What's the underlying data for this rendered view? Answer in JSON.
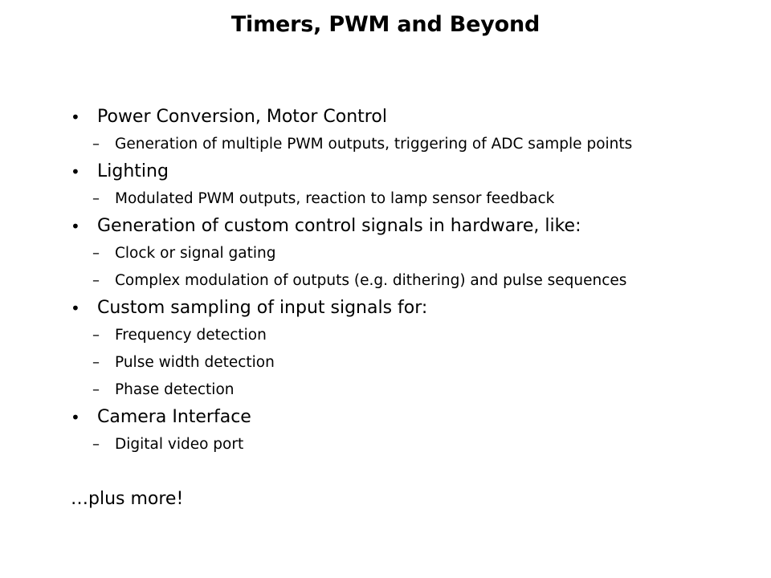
{
  "slide": {
    "title": "Timers, PWM and Beyond",
    "background_color": "#ffffff",
    "text_color": "#000000",
    "markers": {
      "level1": "•",
      "level2": "–"
    },
    "content": [
      {
        "level": 1,
        "text": "Power Conversion, Motor Control"
      },
      {
        "level": 2,
        "text": "Generation of multiple PWM outputs, triggering of ADC sample points"
      },
      {
        "level": 1,
        "text": "Lighting"
      },
      {
        "level": 2,
        "text": "Modulated PWM outputs, reaction to lamp sensor feedback"
      },
      {
        "level": 1,
        "text": "Generation of custom control signals in hardware, like:"
      },
      {
        "level": 2,
        "text": "Clock or signal gating"
      },
      {
        "level": 2,
        "text": "Complex modulation of outputs (e.g. dithering) and pulse sequences"
      },
      {
        "level": 1,
        "text": "Custom sampling of input signals for:"
      },
      {
        "level": 2,
        "text": "Frequency detection"
      },
      {
        "level": 2,
        "text": "Pulse width detection"
      },
      {
        "level": 2,
        "text": "Phase detection"
      },
      {
        "level": 1,
        "text": "Camera Interface"
      },
      {
        "level": 2,
        "text": "Digital video port"
      }
    ],
    "closing_line": "…plus more!"
  }
}
